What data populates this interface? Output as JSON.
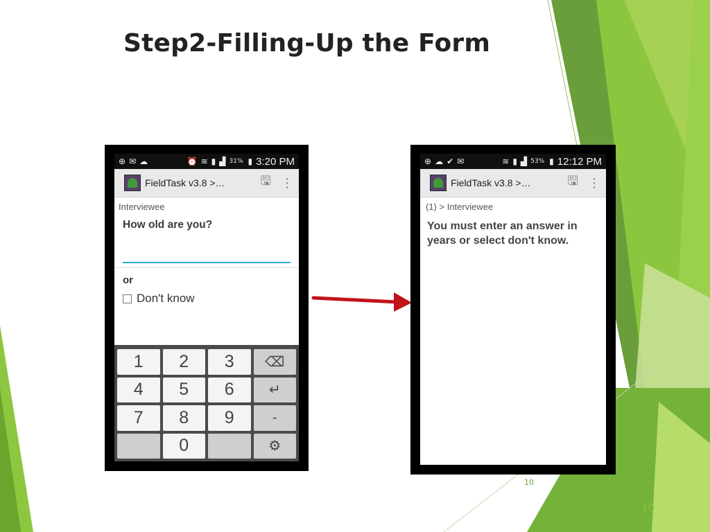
{
  "slide": {
    "title": "Step2-Filling-Up the Form",
    "page_number_small": "10",
    "page_number": "10",
    "accent_colors": [
      "#8dc63f",
      "#6aa52d",
      "#4f7f2a",
      "#c9e29a"
    ]
  },
  "phone_left": {
    "status": {
      "battery": "31%",
      "time": "3:20 PM"
    },
    "appbar": {
      "title": "FieldTask v3.8 >…",
      "save_icon": "save-icon",
      "menu_icon": "overflow-menu-icon"
    },
    "breadcrumb": "Interviewee",
    "question": "How old are you?",
    "answer_value": "",
    "or_label": "or",
    "dont_know_label": "Don't know",
    "keys": [
      "1",
      "2",
      "3",
      "⌫",
      "4",
      "5",
      "6",
      "↵",
      "7",
      "8",
      "9",
      "-",
      "",
      "0",
      "",
      "⚙"
    ]
  },
  "phone_right": {
    "status": {
      "battery": "53%",
      "time": "12:12 PM"
    },
    "appbar": {
      "title": "FieldTask v3.8 >…",
      "save_icon": "save-icon",
      "menu_icon": "overflow-menu-icon"
    },
    "breadcrumb": "(1) > Interviewee",
    "message": "You must enter an answer in years or select don't know."
  }
}
